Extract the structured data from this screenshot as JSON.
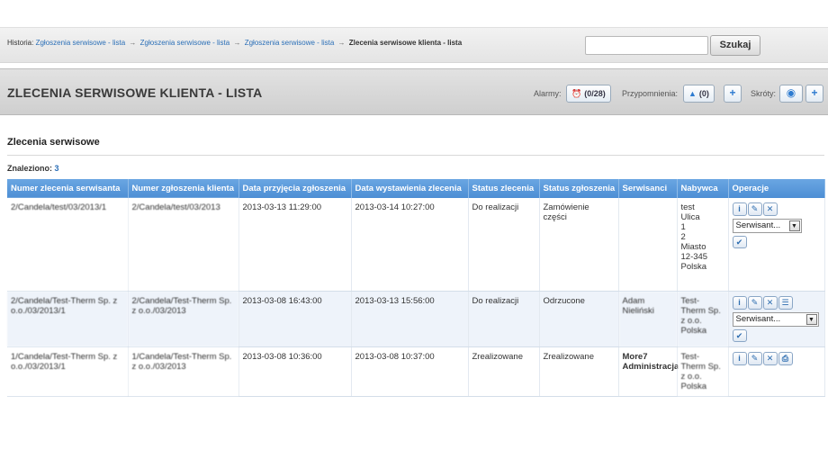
{
  "breadcrumb": {
    "prefix": "Historia:",
    "links": [
      "Zgłoszenia serwisowe - lista",
      "Zgłoszenia serwisowe - lista",
      "Zgłoszenia serwisowe - lista"
    ],
    "separator": "→",
    "current": "Zlecenia serwisowe klienta - lista"
  },
  "search": {
    "value": "",
    "button_label": "Szukaj"
  },
  "header": {
    "title": "ZLECENIA SERWISOWE KLIENTA - LISTA",
    "alarms_label": "Alarmy:",
    "alarms_value": "(0/28)",
    "reminders_label": "Przypomnienia:",
    "reminders_value": "(0)",
    "shortcuts_label": "Skróty:"
  },
  "section": {
    "title": "Zlecenia serwisowe",
    "found_label": "Znaleziono:",
    "found_count": "3"
  },
  "table": {
    "columns": [
      "Numer zlecenia serwisanta",
      "Numer zgłoszenia klienta",
      "Data przyjęcia zgłoszenia",
      "Data wystawienia zlecenia",
      "Status zlecenia",
      "Status zgłoszenia",
      "Serwisanci",
      "Nabywca",
      "Operacje"
    ],
    "rows": [
      {
        "order_no": "2/Candela/test/03/2013/1",
        "request_no": "2/Candela/test/03/2013",
        "date_received": "2013-03-13 11:29:00",
        "date_issued": "2013-03-14 10:27:00",
        "order_status": "Do realizacji",
        "request_status": "Zamówienie części",
        "technicians": "",
        "buyer": "test\nUlica\n1\n2\nMiasto\n12-345\nPolska",
        "select_label": "Serwisant..."
      },
      {
        "order_no": "2/Candela/Test-Therm Sp. z o.o./03/2013/1",
        "request_no": "2/Candela/Test-Therm Sp. z o.o./03/2013",
        "date_received": "2013-03-08 16:43:00",
        "date_issued": "2013-03-13 15:56:00",
        "order_status": "Do realizacji",
        "request_status": "Odrzucone",
        "technicians": "Adam Nieliński",
        "buyer": "Test-Therm Sp. z o.o. Polska",
        "select_label": "Serwisant..."
      },
      {
        "order_no": "1/Candela/Test-Therm Sp. z o.o./03/2013/1",
        "request_no": "1/Candela/Test-Therm Sp. z o.o./03/2013",
        "date_received": "2013-03-08 10:36:00",
        "date_issued": "2013-03-08 10:37:00",
        "order_status": "Zrealizowane",
        "request_status": "Zrealizowane",
        "technicians": "More7 Administracja",
        "buyer": "Test-Therm Sp. z o.o. Polska"
      }
    ]
  },
  "icons": {
    "alarm": "alarm-clock-icon",
    "reminder": "bell-icon",
    "info": "info-icon",
    "edit": "pencil-icon",
    "delete": "close-icon",
    "list": "list-icon",
    "print": "printer-icon",
    "confirm": "check-icon"
  },
  "colors": {
    "accent_blue": "#4d8ed4",
    "link_blue": "#2b6fb7"
  }
}
